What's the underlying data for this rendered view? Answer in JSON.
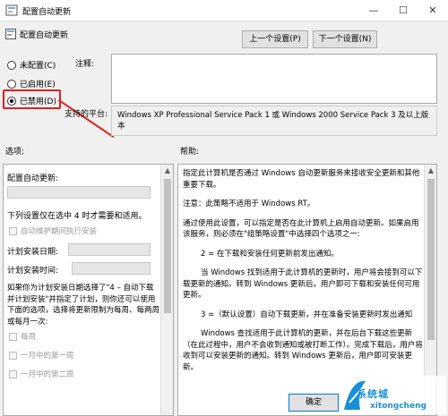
{
  "window": {
    "title": "配置自动更新",
    "minimize": "—",
    "maximize": "☐",
    "close": "✕"
  },
  "header": {
    "title": "配置自动更新",
    "prev_button": "上一个设置(P)",
    "next_button": "下一个设置(N)"
  },
  "state": {
    "options": [
      {
        "label": "未配置(C)",
        "selected": false
      },
      {
        "label": "已启用(E)",
        "selected": false
      },
      {
        "label": "已禁用(D)",
        "selected": true
      }
    ],
    "comment_label": "注释:",
    "supported_label": "支持的平台:",
    "supported_value": "Windows XP Professional Service Pack 1 或 Windows 2000 Service Pack 3 及以上版本"
  },
  "options_panel": {
    "label": "选项:",
    "configure_label": "配置自动更新:",
    "note": "下列设置仅在选中 4 时才需要和适用。",
    "maintenance_checkbox": "自动维护期间执行安装",
    "install_day_label": "计划安装日期:",
    "install_time_label": "计划安装时间:",
    "text_lines": [
      "如果你为计划安装日期选择了\"4 – 自动下载",
      "并计划安装\"并指定了计划，则你还可以使用",
      "下面的选项，选择将更新限制为每周、每两周",
      "或每月一次:"
    ],
    "checkboxes": [
      "每周",
      "一月中的第一周",
      "一月中的第二周"
    ]
  },
  "help_panel": {
    "label": "帮助:",
    "paragraphs": [
      "指定此计算机是否通过 Windows 自动更新服务来接收安全更新和其他重要下载。",
      "注意：此策略不适用于 Windows RT。",
      "通过使用此设置，可以指定是否在此计算机上启用自动更新。如果启用该服务，则必须在\"组策略设置\"中选择四个选项之一:",
      "2 = 在下载和安装任何更新前发出通知。",
      "当 Windows 找到适用于此计算机的更新时，用户将会接到可以下载更新的通知。转到 Windows 更新后，用户即可下载和安装任何可用更新。",
      "3 =（默认设置）自动下载更新，并在准备安装更新时发出通知",
      "Windows 查找适用于此计算机的更新，并在后台下载这些更新（在此过程中，用户不会收到通知或被打断工作）。完成下载后，用户将收到可以安装更新的通知。转到 Windows 更新后，用户即可安装更新。"
    ]
  },
  "footer": {
    "ok_button": "确定"
  },
  "watermark": {
    "line1": "系统城",
    "line2": "xitongcheng"
  },
  "colors": {
    "highlight": "#e02020",
    "accent": "#0078d7"
  }
}
